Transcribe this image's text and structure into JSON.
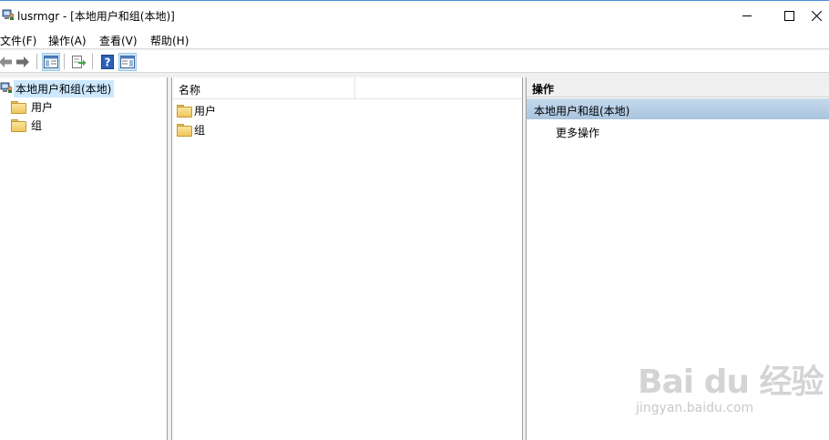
{
  "window": {
    "title": "lusrmgr - [本地用户和组(本地)]",
    "icon": "computer-users-icon",
    "controls": [
      "minimize-icon",
      "maximize-icon",
      "close-icon"
    ]
  },
  "menu": {
    "items": [
      "文件(F)",
      "操作(A)",
      "查看(V)",
      "帮助(H)"
    ]
  },
  "toolbar": {
    "buttons": [
      "back-arrow-icon",
      "forward-arrow-icon",
      "show-hide-console-tree-icon",
      "export-list-icon",
      "help-icon",
      "show-hide-action-pane-icon"
    ]
  },
  "tree": {
    "root": "本地用户和组(本地)",
    "children": [
      "用户",
      "组"
    ]
  },
  "list": {
    "columns": [
      "名称"
    ],
    "items": [
      "用户",
      "组"
    ]
  },
  "actions": {
    "header": "操作",
    "section": "本地用户和组(本地)",
    "items": [
      "更多操作"
    ]
  },
  "watermark": {
    "brand": "Bai du 经验",
    "url": "jingyan.baidu.com"
  },
  "colors": {
    "selection": "#cce8ff",
    "action_section": "#b3cbe4",
    "title_accent": "#4a90d9"
  }
}
